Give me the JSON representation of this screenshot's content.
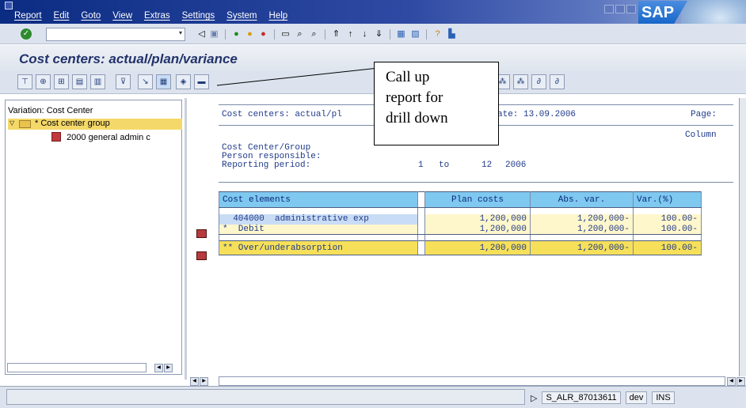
{
  "menu": [
    "Report",
    "Edit",
    "Goto",
    "View",
    "Extras",
    "Settings",
    "System",
    "Help"
  ],
  "brand": "SAP",
  "command_field": {
    "value": ""
  },
  "page_title": "Cost centers: actual/plan/variance",
  "callout": {
    "lines": [
      "Call up",
      "report for",
      "drill down"
    ]
  },
  "tree": {
    "title": "Variation: Cost Center",
    "root": "* Cost center group",
    "child": "2000 general admin c"
  },
  "report": {
    "header_title": "Cost centers: actual/pl",
    "date_label": "ate: 13.09.2006",
    "page_label": "Page:",
    "column_label": "Column",
    "cost_center_label": "Cost Center/Group",
    "cost_center_value": "*",
    "person_label": "Person responsible:",
    "period_label": "Reporting period:",
    "period_from": "1",
    "period_to_label": "to",
    "period_to": "12",
    "period_year": "2006"
  },
  "table": {
    "headers": [
      "Cost elements",
      "Plan costs",
      "Abs. var.",
      "Var.(%)"
    ],
    "rows": [
      [
        "  404000  administrative exp",
        "1,200,000",
        "1,200,000-",
        "100.00-"
      ],
      [
        "*  Debit",
        "1,200,000",
        "1,200,000-",
        "100.00-"
      ],
      [
        "** Over/underabsorption",
        "1,200,000",
        "1,200,000-",
        "100.00-"
      ]
    ]
  },
  "status": {
    "program": "S_ALR_87013611",
    "system": "dev",
    "mode": "INS"
  }
}
